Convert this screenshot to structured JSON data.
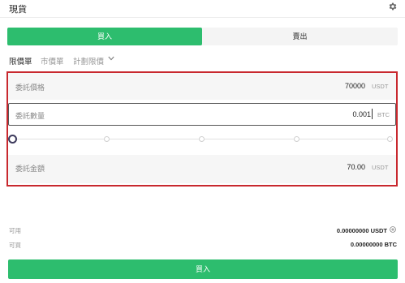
{
  "header": {
    "title": "現貨",
    "settings_icon": "gear-icon"
  },
  "tabs": {
    "buy_label": "買入",
    "sell_label": "賣出",
    "active": "buy",
    "accent_color": "#2dbd6e"
  },
  "order_types": [
    {
      "label": "限價單",
      "active": true
    },
    {
      "label": "市價單",
      "active": false
    },
    {
      "label": "計劃限價",
      "active": false,
      "dropdown": true
    }
  ],
  "form": {
    "price": {
      "label": "委託價格",
      "value": "70000",
      "unit": "USDT"
    },
    "quantity": {
      "label": "委託數量",
      "value": "0.001",
      "unit": "BTC"
    },
    "slider": {
      "percent": 0,
      "stops": [
        0,
        25,
        50,
        75,
        100
      ]
    },
    "total": {
      "label": "委託金額",
      "value": "70.00",
      "unit": "USDT"
    },
    "highlight_color": "#c8282e"
  },
  "balances": {
    "available": {
      "label": "可用",
      "value": "0.00000000 USDT"
    },
    "buyable": {
      "label": "可買",
      "value": "0.00000000 BTC"
    }
  },
  "submit": {
    "label": "買入"
  }
}
